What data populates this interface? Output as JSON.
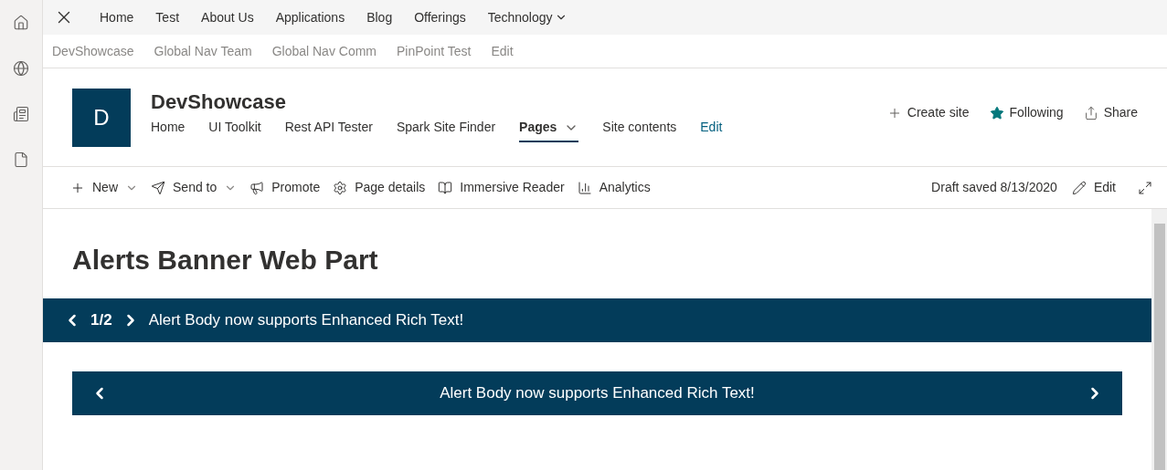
{
  "top_nav": {
    "items": [
      {
        "label": "Home",
        "kind": "link"
      },
      {
        "label": "Test",
        "kind": "link"
      },
      {
        "label": "About Us",
        "kind": "link"
      },
      {
        "label": "Applications",
        "kind": "link"
      },
      {
        "label": "Blog",
        "kind": "link"
      },
      {
        "label": "Offerings",
        "kind": "link"
      },
      {
        "label": "Technology",
        "kind": "dropdown"
      }
    ]
  },
  "hub_nav": {
    "items": [
      "DevShowcase",
      "Global Nav Team",
      "Global Nav Comm",
      "PinPoint Test",
      "Edit"
    ]
  },
  "site": {
    "logo": "D",
    "title": "DevShowcase",
    "nav": [
      {
        "label": "Home",
        "kind": "link",
        "selected": false
      },
      {
        "label": "UI Toolkit",
        "kind": "link",
        "selected": false
      },
      {
        "label": "Rest API Tester",
        "kind": "link",
        "selected": false
      },
      {
        "label": "Spark Site Finder",
        "kind": "link",
        "selected": false
      },
      {
        "label": "Pages",
        "kind": "dropdown",
        "selected": true
      },
      {
        "label": "Site contents",
        "kind": "link",
        "selected": false
      },
      {
        "label": "Edit",
        "kind": "edit",
        "selected": false
      }
    ],
    "actions": [
      {
        "label": "Create site",
        "kind": "plus"
      },
      {
        "label": "Following",
        "kind": "star"
      },
      {
        "label": "Share",
        "kind": "share"
      }
    ]
  },
  "command_bar": {
    "items": [
      {
        "label": "New",
        "kind": "plus",
        "dropdown": true
      },
      {
        "label": "Send to",
        "kind": "send",
        "dropdown": true
      },
      {
        "label": "Promote",
        "kind": "megaphone",
        "dropdown": false
      },
      {
        "label": "Page details",
        "kind": "gear",
        "dropdown": false
      },
      {
        "label": "Immersive Reader",
        "kind": "reader",
        "dropdown": false
      },
      {
        "label": "Analytics",
        "kind": "chart",
        "dropdown": false
      }
    ],
    "status": "Draft saved 8/13/2020",
    "edit": "Edit"
  },
  "page": {
    "title": "Alerts Banner Web Part",
    "banners": [
      {
        "kind": "counter",
        "counter": "1/2",
        "text": "Alert Body now supports Enhanced Rich Text!"
      },
      {
        "kind": "centered",
        "text": "Alert Body now supports Enhanced Rich Text!"
      }
    ]
  }
}
